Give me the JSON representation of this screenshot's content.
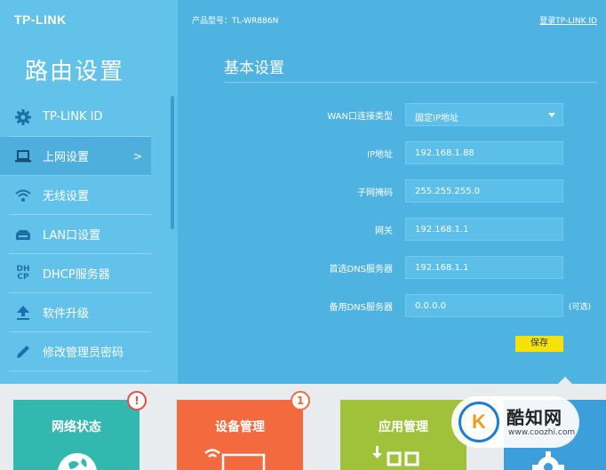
{
  "brand": {
    "logo": "TP-LINK"
  },
  "sidebar": {
    "title": "路由设置",
    "items": [
      {
        "label": "TP-LINK ID",
        "icon": "gear-icon"
      },
      {
        "label": "上网设置",
        "icon": "laptop-icon",
        "active": true,
        "chevron": ">"
      },
      {
        "label": "无线设置",
        "icon": "wifi-icon"
      },
      {
        "label": "LAN口设置",
        "icon": "lan-icon"
      },
      {
        "label": "DHCP服务器",
        "icon": "dhcp-icon",
        "icon_text_top": "DH",
        "icon_text_bottom": "CP"
      },
      {
        "label": "软件升级",
        "icon": "upload-icon"
      },
      {
        "label": "修改管理员密码",
        "icon": "pencil-icon"
      }
    ]
  },
  "header": {
    "model": "产品型号：TL-WR886N",
    "login": "登录TP-LINK ID"
  },
  "main": {
    "title": "基本设置",
    "form": {
      "wan_type": {
        "label": "WAN口连接类型",
        "value": "固定IP地址"
      },
      "ip": {
        "label": "IP地址",
        "value": "192.168.1.88"
      },
      "mask": {
        "label": "子网掩码",
        "value": "255.255.255.0"
      },
      "gateway": {
        "label": "网关",
        "value": "192.168.1.1"
      },
      "dns1": {
        "label": "首选DNS服务器",
        "value": "192.168.1.1"
      },
      "dns2": {
        "label": "备用DNS服务器",
        "value": "0.0.0.0",
        "suffix": "(可选)"
      }
    },
    "save_label": "保存"
  },
  "tiles": [
    {
      "label": "网络状态",
      "badge": "!",
      "color": "#32b8ae"
    },
    {
      "label": "设备管理",
      "badge": "1",
      "color": "#f26a3e"
    },
    {
      "label": "应用管理",
      "color": "#a0c23b"
    },
    {
      "label": "",
      "color": "#3c9edb"
    }
  ],
  "watermark": {
    "name": "酷知网",
    "url": "www.coozhi.com",
    "mark": "K"
  },
  "colors": {
    "accent": "#4fb3e2",
    "sidebar": "#63c2ea",
    "save": "#f5e20a"
  }
}
